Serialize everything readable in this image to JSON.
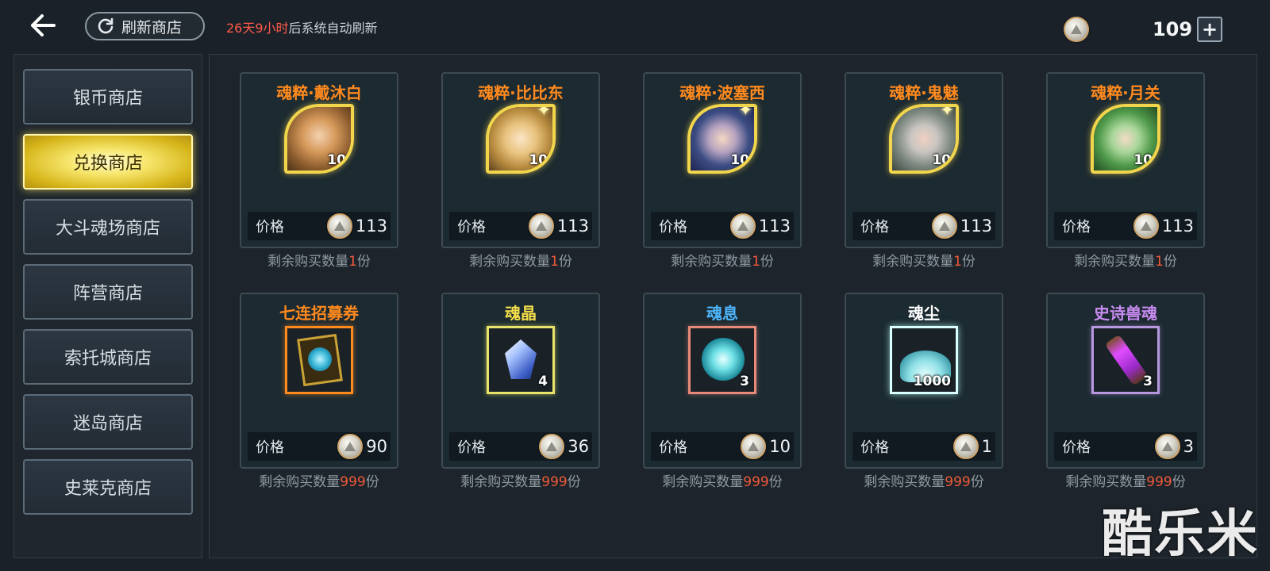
{
  "topbar": {
    "refresh_label": "刷新商店",
    "refresh_info_prefix": "26天9小时",
    "refresh_info_suffix": "后系统自动刷新",
    "currency_amount": "109",
    "plus_label": "+"
  },
  "sidebar": {
    "items": [
      {
        "label": "银币商店",
        "active": false
      },
      {
        "label": "兑换商店",
        "active": true
      },
      {
        "label": "大斗魂场商店",
        "active": false
      },
      {
        "label": "阵营商店",
        "active": false
      },
      {
        "label": "索托城商店",
        "active": false
      },
      {
        "label": "迷岛商店",
        "active": false
      },
      {
        "label": "史莱克商店",
        "active": false
      }
    ]
  },
  "shop": {
    "price_label": "价格",
    "remain_prefix": "剩余购买数量",
    "remain_suffix": "份",
    "items": [
      {
        "name": "魂粹·戴沐白",
        "count": "10",
        "price": "113",
        "remain": "1",
        "name_color": "#ff8a1e",
        "icon": "dai-mubai-portrait-icon"
      },
      {
        "name": "魂粹·比比东",
        "count": "10",
        "price": "113",
        "remain": "1",
        "name_color": "#ff8a1e",
        "icon": "bibi-dong-portrait-icon"
      },
      {
        "name": "魂粹·波塞西",
        "count": "10",
        "price": "113",
        "remain": "1",
        "name_color": "#ff8a1e",
        "icon": "bo-saixi-portrait-icon"
      },
      {
        "name": "魂粹·鬼魅",
        "count": "10",
        "price": "113",
        "remain": "1",
        "name_color": "#ff8a1e",
        "icon": "gui-mei-portrait-icon"
      },
      {
        "name": "魂粹·月关",
        "count": "10",
        "price": "113",
        "remain": "1",
        "name_color": "#ff8a1e",
        "icon": "yue-guan-portrait-icon"
      },
      {
        "name": "七连招募券",
        "count": "",
        "price": "90",
        "remain": "999",
        "name_color": "#ff8a1e",
        "icon": "recruit-ticket-icon"
      },
      {
        "name": "魂晶",
        "count": "4",
        "price": "36",
        "remain": "999",
        "name_color": "#f5de4a",
        "icon": "soul-crystal-icon"
      },
      {
        "name": "魂息",
        "count": "3",
        "price": "10",
        "remain": "999",
        "name_color": "#4fb6ff",
        "icon": "soul-breath-icon"
      },
      {
        "name": "魂尘",
        "count": "1000",
        "price": "1",
        "remain": "999",
        "name_color": "#ffffff",
        "icon": "soul-dust-icon"
      },
      {
        "name": "史诗兽魂",
        "count": "3",
        "price": "3",
        "remain": "999",
        "name_color": "#c98cf2",
        "icon": "epic-beast-soul-icon"
      }
    ]
  },
  "watermark": "酷乐米"
}
